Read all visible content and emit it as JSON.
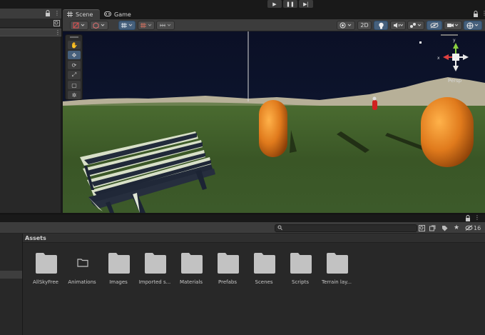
{
  "play_controls": {
    "play_icon": "play-icon",
    "pause_icon": "pause-icon",
    "step_icon": "step-icon",
    "play": "▶",
    "pause": "❚❚",
    "step": "▶|"
  },
  "hierarchy": {
    "lock_glyph": "a",
    "menu_glyph": "⋮"
  },
  "scene_tabs": [
    {
      "label": "Scene",
      "active": true,
      "icon": "grid-icon"
    },
    {
      "label": "Game",
      "active": false,
      "icon": "gamepad-icon"
    }
  ],
  "scene_toolbar": {
    "mode_2d": "2D",
    "gizmo_label": "Persp"
  },
  "tool_palette": [
    {
      "name": "hand-tool",
      "glyph": "✋",
      "selected": false
    },
    {
      "name": "move-tool",
      "glyph": "✥",
      "selected": true
    },
    {
      "name": "rotate-tool",
      "glyph": "⟳",
      "selected": false
    },
    {
      "name": "scale-tool",
      "glyph": "⤢",
      "selected": false
    },
    {
      "name": "rect-tool",
      "glyph": "▢",
      "selected": false
    },
    {
      "name": "transform-tool",
      "glyph": "✲",
      "selected": false
    }
  ],
  "project": {
    "folder_title": "Assets",
    "hidden_count": "16",
    "lock_glyph": "a",
    "menu_glyph": "⋮"
  },
  "assets": [
    {
      "label": "AllSkyFree",
      "icon": "folder-icon"
    },
    {
      "label": "Animations",
      "icon": "empty-folder-icon"
    },
    {
      "label": "Images",
      "icon": "folder-icon"
    },
    {
      "label": "Imported s...",
      "icon": "folder-icon"
    },
    {
      "label": "Materials",
      "icon": "folder-icon"
    },
    {
      "label": "Prefabs",
      "icon": "folder-icon"
    },
    {
      "label": "Scenes",
      "icon": "folder-icon"
    },
    {
      "label": "Scripts",
      "icon": "folder-icon"
    },
    {
      "label": "Terrain lay...",
      "icon": "folder-icon"
    }
  ],
  "colors": {
    "editor_bg": "#191919",
    "panel_bg": "#282828",
    "toolbar_bg": "#3c3c3c",
    "accent_blue": "#46607c",
    "sky": "#0c1228",
    "grass": "#3c5a28",
    "capsule_orange": "#e07a1c",
    "bench": "#252c3c",
    "folder": "#c2c2c2"
  }
}
